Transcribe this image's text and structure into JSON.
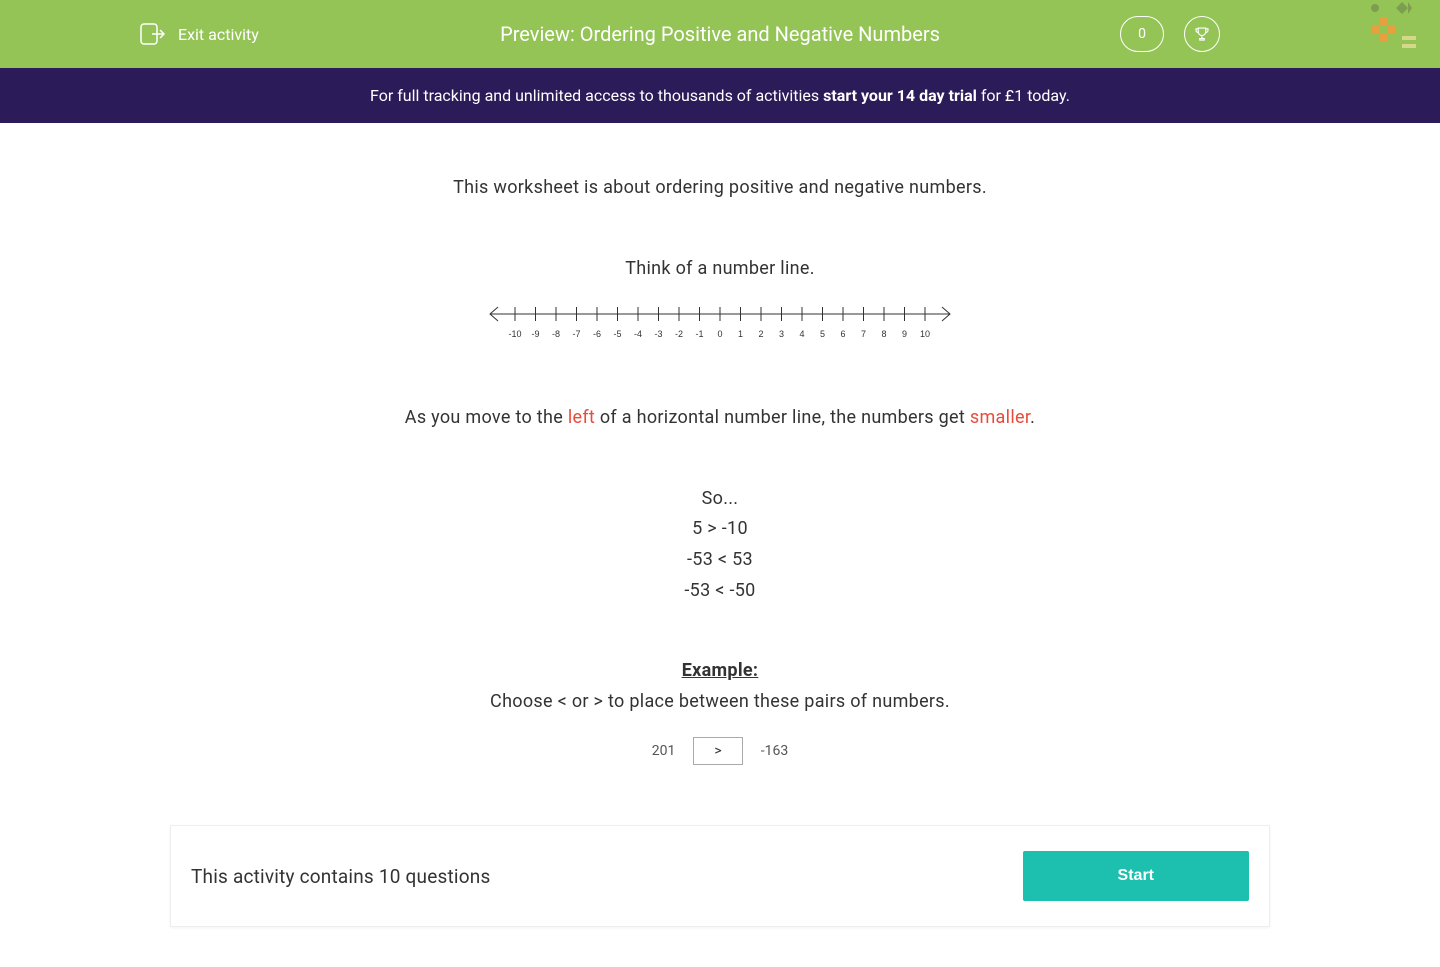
{
  "header": {
    "exit_label": "Exit activity",
    "title": "Preview: Ordering Positive and Negative Numbers",
    "score": "0"
  },
  "banner": {
    "prefix": "For full tracking and unlimited access to thousands of activities ",
    "bold": "start your 14 day trial",
    "suffix": " for £1 today."
  },
  "content": {
    "intro": "This worksheet is about ordering positive and negative numbers.",
    "think": "Think of a number line.",
    "number_line_ticks": [
      "-10",
      "-9",
      "-8",
      "-7",
      "-6",
      "-5",
      "-4",
      "-3",
      "-2",
      "-1",
      "0",
      "1",
      "2",
      "3",
      "4",
      "5",
      "6",
      "7",
      "8",
      "9",
      "10"
    ],
    "rule_prefix": "As you move to the ",
    "rule_left": "left",
    "rule_middle": " of a horizontal number line, the numbers get ",
    "rule_smaller": "smaller",
    "rule_suffix": ".",
    "so": "So...",
    "ex1": "5 > -10",
    "ex2": "-53 < 53",
    "ex3": "-53 < -50",
    "example_heading": "Example:",
    "example_instruction": "Choose < or > to place between these pairs of numbers.",
    "comparison": {
      "left": "201",
      "symbol": ">",
      "right": "-163"
    }
  },
  "footer": {
    "text": "This activity contains 10 questions",
    "start": "Start"
  }
}
